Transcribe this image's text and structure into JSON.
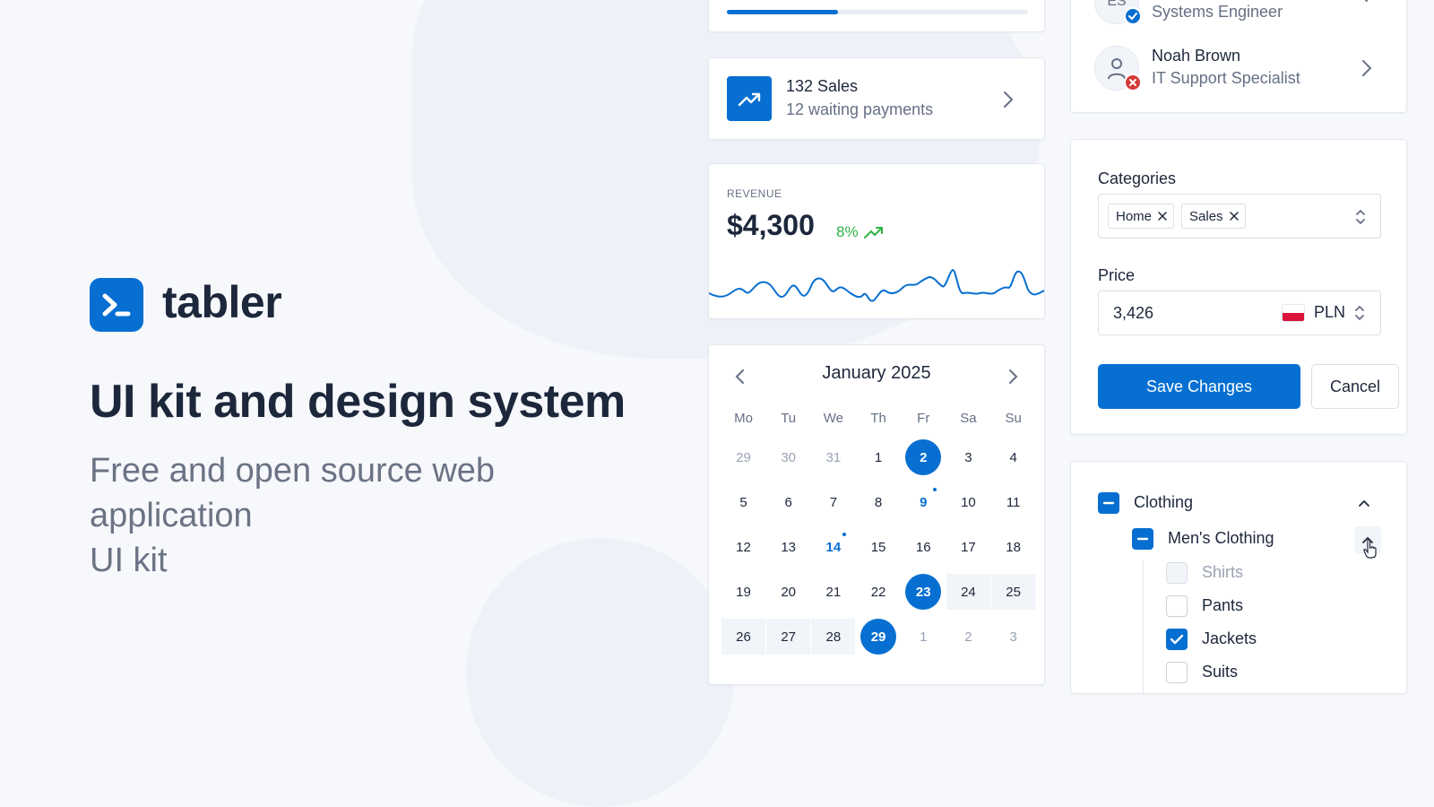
{
  "brand": {
    "name": "tabler"
  },
  "hero": {
    "title": "UI kit and design system",
    "subtitle_line1": "Free and open source web",
    "subtitle_line2": "application",
    "subtitle_line3": "UI kit"
  },
  "progress_card": {
    "progress": 0.37
  },
  "sales_card": {
    "title": "132 Sales",
    "subtitle": "12 waiting payments"
  },
  "revenue_card": {
    "label": "REVENUE",
    "value": "$4,300",
    "change": "8%"
  },
  "calendar": {
    "month": "January 2025",
    "weekdays": [
      "Mo",
      "Tu",
      "We",
      "Th",
      "Fr",
      "Sa",
      "Su"
    ],
    "weeks": [
      [
        "29",
        "30",
        "31",
        "1",
        "2",
        "3",
        "4"
      ],
      [
        "5",
        "6",
        "7",
        "8",
        "9",
        "10",
        "11"
      ],
      [
        "12",
        "13",
        "14",
        "15",
        "16",
        "17",
        "18"
      ],
      [
        "19",
        "20",
        "21",
        "22",
        "23",
        "24",
        "25"
      ],
      [
        "26",
        "27",
        "28",
        "29",
        "1",
        "2",
        "3"
      ]
    ]
  },
  "people": [
    {
      "initials": "ES",
      "role": "Systems Engineer",
      "status": "verified"
    },
    {
      "name": "Noah Brown",
      "role": "IT Support Specialist",
      "status": "error"
    }
  ],
  "form": {
    "categories_label": "Categories",
    "tags": [
      "Home",
      "Sales"
    ],
    "price_label": "Price",
    "price_value": "3,426",
    "currency": "PLN",
    "save_label": "Save Changes",
    "cancel_label": "Cancel"
  },
  "tree": {
    "root": "Clothing",
    "group": "Men's Clothing",
    "items": [
      {
        "label": "Shirts",
        "state": "disabled"
      },
      {
        "label": "Pants",
        "state": "unchecked"
      },
      {
        "label": "Jackets",
        "state": "checked"
      },
      {
        "label": "Suits",
        "state": "unchecked"
      }
    ]
  },
  "colors": {
    "primary": "#066fd1",
    "success": "#2fb344",
    "danger": "#d63939"
  }
}
